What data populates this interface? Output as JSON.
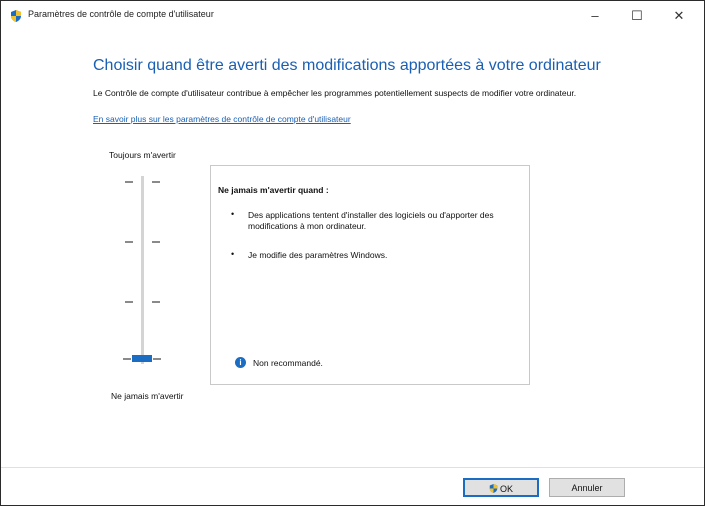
{
  "window": {
    "title": "Paramètres de contrôle de compte d'utilisateur",
    "controls": {
      "minimize": "–",
      "maximize": "☐",
      "close": "✕"
    }
  },
  "content": {
    "heading": "Choisir quand être averti des modifications apportées à votre ordinateur",
    "description": "Le Contrôle de compte d'utilisateur contribue à empêcher les programmes potentiellement suspects de modifier votre ordinateur.",
    "learn_more_link": "En savoir plus sur les paramètres de contrôle de compte d'utilisateur"
  },
  "slider": {
    "top_label": "Toujours m'avertir",
    "bottom_label": "Ne jamais m'avertir",
    "levels": 4,
    "selected_level": 1,
    "accent": "#1b6dc4"
  },
  "panel": {
    "title": "Ne jamais m'avertir quand :",
    "bullets": [
      "Des applications tentent d'installer des logiciels ou d'apporter des modifications à mon ordinateur.",
      "Je modifie des paramètres Windows."
    ],
    "info_icon": "info-icon",
    "info_text": "Non recommandé."
  },
  "footer": {
    "ok_label": "OK",
    "cancel_label": "Annuler"
  }
}
